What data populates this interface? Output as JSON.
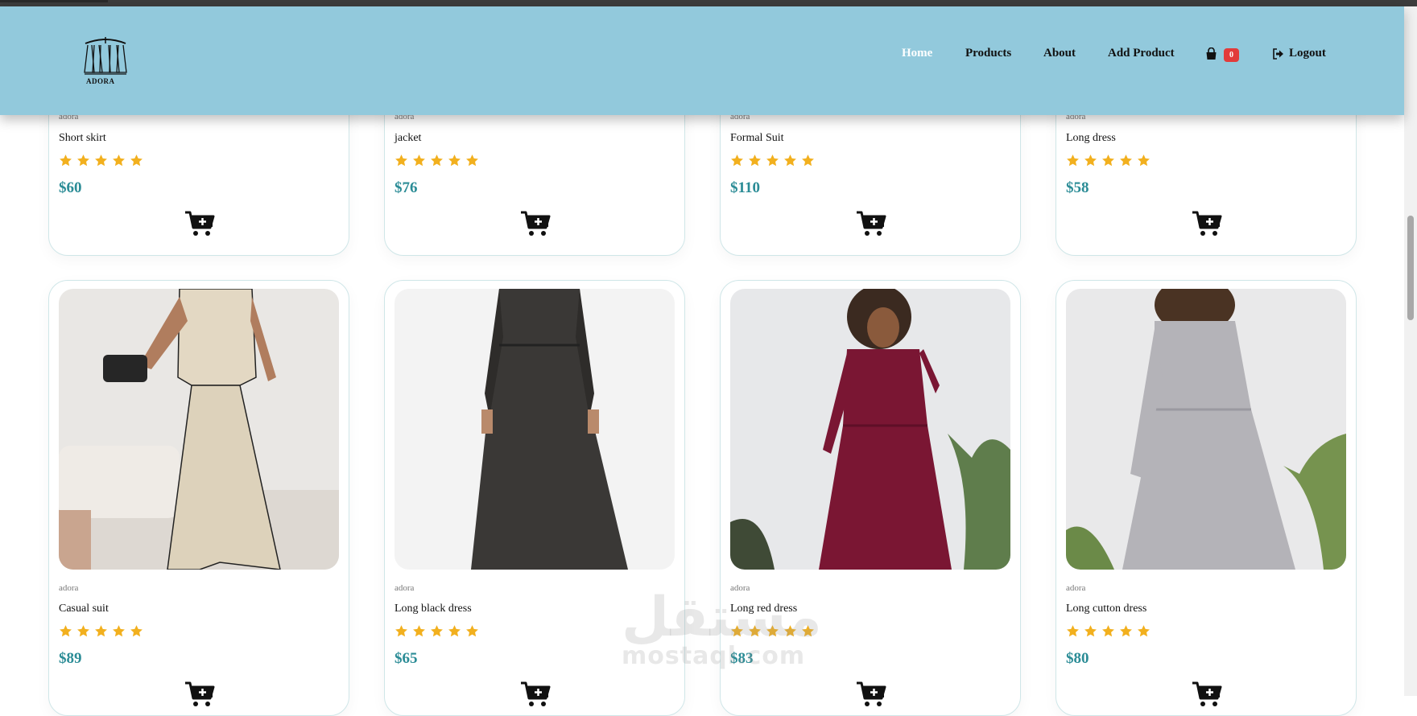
{
  "header": {
    "logo_text": "ADORA",
    "nav": {
      "home": "Home",
      "products": "Products",
      "about": "About",
      "add_product": "Add Product",
      "cart_count": "0",
      "logout": "Logout"
    }
  },
  "colors": {
    "header_bg": "#92c9dc",
    "price": "#2b8c96",
    "star": "#f2b01e",
    "badge": "#e23b3b"
  },
  "products_top": [
    {
      "brand": "adora",
      "name": "Short skirt",
      "rating": 5,
      "price": "$60"
    },
    {
      "brand": "adora",
      "name": "jacket",
      "rating": 5,
      "price": "$76"
    },
    {
      "brand": "adora",
      "name": "Formal Suit",
      "rating": 5,
      "price": "$110"
    },
    {
      "brand": "adora",
      "name": "Long dress",
      "rating": 5,
      "price": "$58"
    }
  ],
  "products_bottom": [
    {
      "brand": "adora",
      "name": "Casual suit",
      "rating": 5,
      "price": "$89"
    },
    {
      "brand": "adora",
      "name": "Long black dress",
      "rating": 5,
      "price": "$65"
    },
    {
      "brand": "adora",
      "name": "Long red dress",
      "rating": 5,
      "price": "$83"
    },
    {
      "brand": "adora",
      "name": "Long cutton dress",
      "rating": 5,
      "price": "$80"
    }
  ],
  "watermark": {
    "arabic": "مستقل",
    "latin": "mostaql.com"
  }
}
